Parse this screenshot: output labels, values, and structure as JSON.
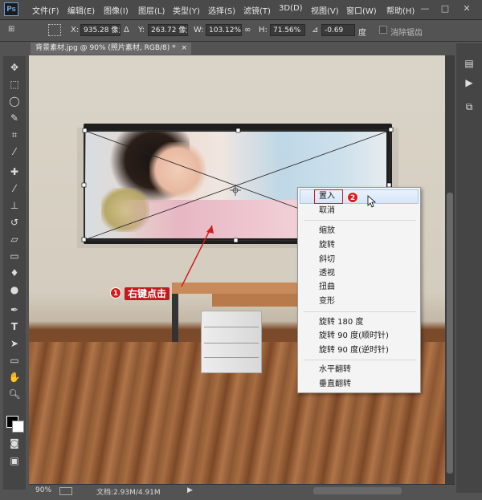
{
  "app": {
    "logo": "Ps"
  },
  "menubar": {
    "items": [
      "文件(F)",
      "编辑(E)",
      "图像(I)",
      "图层(L)",
      "类型(Y)",
      "选择(S)",
      "滤镜(T)",
      "3D(D)",
      "视图(V)",
      "窗口(W)",
      "帮助(H)"
    ],
    "window_buttons": {
      "minimize": "—",
      "maximize": "□",
      "close": "✕"
    }
  },
  "options": {
    "x_label": "X:",
    "x_value": "935.28 像素",
    "delta": "Δ",
    "y_label": "Y:",
    "y_value": "263.72 像素",
    "w_label": "W:",
    "w_value": "103.12%",
    "link": "∞",
    "h_label": "H:",
    "h_value": "71.56%",
    "angle_label": "⊿",
    "angle_value": "-0.69",
    "angle_unit": "度",
    "antialias_label": "消除锯齿"
  },
  "document": {
    "tab_title": "背景素材.jpg @ 90% (照片素材, RGB/8) *",
    "tab_close": "×"
  },
  "context_menu": {
    "items": [
      "置入",
      "取消",
      "缩放",
      "旋转",
      "斜切",
      "透视",
      "扭曲",
      "变形",
      "旋转 180 度",
      "旋转 90 度(顺时针)",
      "旋转 90 度(逆时针)",
      "水平翻转",
      "垂直翻转"
    ],
    "highlighted_index": 0
  },
  "annotations": {
    "badge1": "1",
    "callout1": "右键点击",
    "badge2": "2"
  },
  "status": {
    "zoom": "90%",
    "doc_size": "文档:2.93M/4.91M"
  },
  "icons": {
    "move": "move-icon",
    "marquee": "marquee-icon",
    "lasso": "lasso-icon",
    "quick-select": "quick-select-icon",
    "crop": "crop-icon",
    "eyedropper": "eyedropper-icon",
    "healing": "healing-brush-icon",
    "brush": "brush-icon",
    "stamp": "clone-stamp-icon",
    "history-brush": "history-brush-icon",
    "eraser": "eraser-icon",
    "gradient": "gradient-icon",
    "blur": "blur-icon",
    "dodge": "dodge-icon",
    "pen": "pen-icon",
    "type": "type-icon",
    "path-select": "path-select-icon",
    "shape": "rectangle-shape-icon",
    "hand": "hand-icon",
    "zoom": "zoom-icon"
  },
  "colors": {
    "accent_red": "#d21d1d",
    "menu_highlight": "#d6e6f8"
  }
}
